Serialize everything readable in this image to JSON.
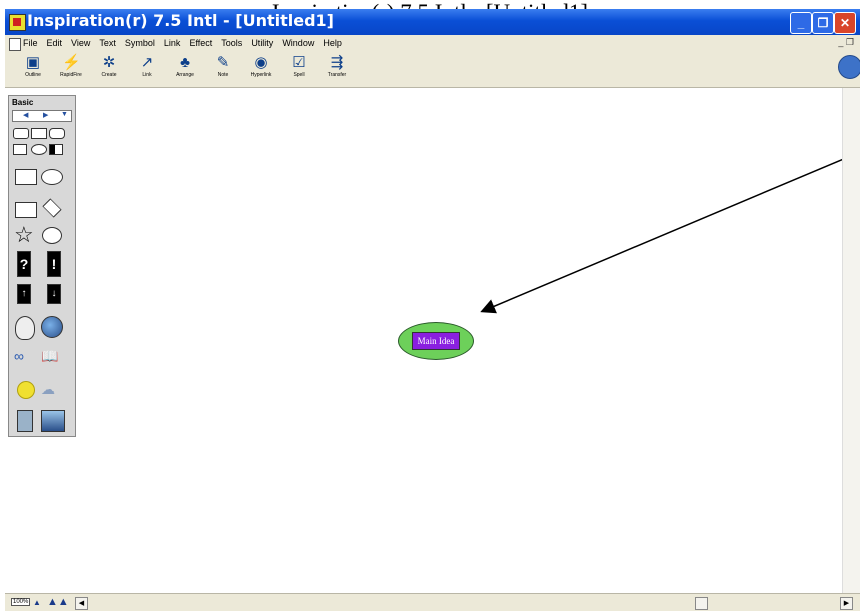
{
  "page": {
    "title": "Inspiration(r) 7.5 Intl - [Untitled1]"
  },
  "window": {
    "title": "Inspiration(r) 7.5 Intl - [Untitled1]",
    "controls": {
      "minimize": "_",
      "restore": "❐",
      "close": "✕"
    }
  },
  "menu": {
    "items": [
      "File",
      "Edit",
      "View",
      "Text",
      "Symbol",
      "Link",
      "Effect",
      "Tools",
      "Utility",
      "Window",
      "Help"
    ],
    "mdi_controls": "_ ❐"
  },
  "toolbar": {
    "tools": [
      {
        "label": "Outline",
        "icon": "outline-icon"
      },
      {
        "label": "RapidFire",
        "icon": "rapidfire-icon"
      },
      {
        "label": "Create",
        "icon": "create-icon"
      },
      {
        "label": "Link",
        "icon": "link-icon"
      },
      {
        "label": "Arrange",
        "icon": "arrange-icon"
      },
      {
        "label": "Note",
        "icon": "note-icon"
      },
      {
        "label": "Hyperlink",
        "icon": "hyperlink-icon"
      },
      {
        "label": "Spell",
        "icon": "spell-icon"
      },
      {
        "label": "Transfer",
        "icon": "transfer-icon"
      }
    ]
  },
  "palette": {
    "title": "Basic"
  },
  "diagram": {
    "main_idea": "Main Idea"
  },
  "statusbar": {
    "zoom": "100%"
  },
  "colors": {
    "titlebar": "#0a4fd6",
    "main_idea_fill": "#6dd05a",
    "main_idea_label_bg": "#8a1fe0",
    "chrome": "#ece9d8"
  }
}
